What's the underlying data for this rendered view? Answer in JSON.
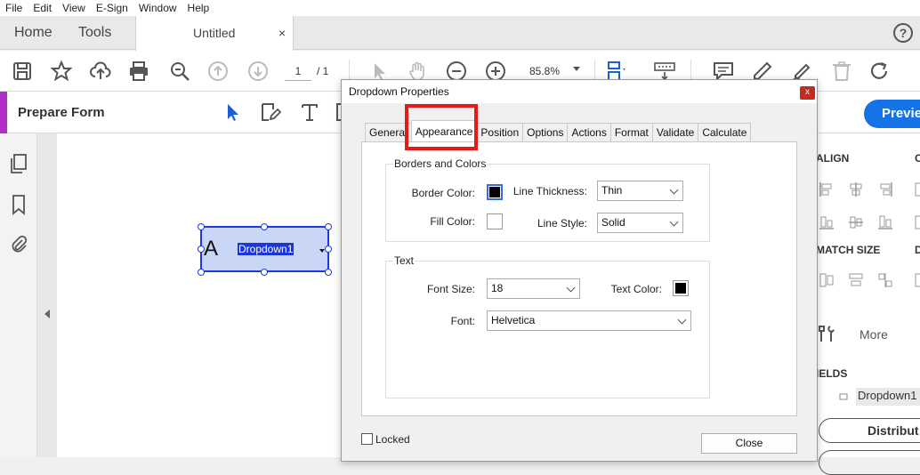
{
  "menubar": [
    "File",
    "Edit",
    "View",
    "E-Sign",
    "Window",
    "Help"
  ],
  "tabs": {
    "home": "Home",
    "tools": "Tools",
    "doc_title": "Untitled",
    "doc_close": "×"
  },
  "help": "?",
  "toolbar": {
    "page_current": "1",
    "page_total": "/ 1",
    "zoom": "85.8%"
  },
  "formbar": {
    "title": "Prepare Form",
    "preview_label": "Previe"
  },
  "field": {
    "letter": "A",
    "name": "Dropdown1"
  },
  "rightpanel": {
    "align_head": "ALIGN",
    "c_head": "C",
    "match_head": "MATCH SIZE",
    "d_head": "D",
    "more": "More",
    "fields_head": "IELDS",
    "field_item": "Dropdown1",
    "distribute": "Distribut"
  },
  "dialog": {
    "title": "Dropdown Properties",
    "close_x": "x",
    "tabs": [
      "General",
      "Appearance",
      "Position",
      "Options",
      "Actions",
      "Format",
      "Validate",
      "Calculate"
    ],
    "active_tab": "Appearance",
    "borders_group": "Borders and Colors",
    "border_color_label": "Border Color:",
    "fill_color_label": "Fill Color:",
    "line_thickness_label": "Line Thickness:",
    "line_thickness_value": "Thin",
    "line_style_label": "Line Style:",
    "line_style_value": "Solid",
    "text_group": "Text",
    "font_size_label": "Font Size:",
    "font_size_value": "18",
    "text_color_label": "Text Color:",
    "font_label": "Font:",
    "font_value": "Helvetica",
    "locked_label": "Locked",
    "close_label": "Close",
    "border_color": "#000000",
    "text_color": "#000000"
  }
}
